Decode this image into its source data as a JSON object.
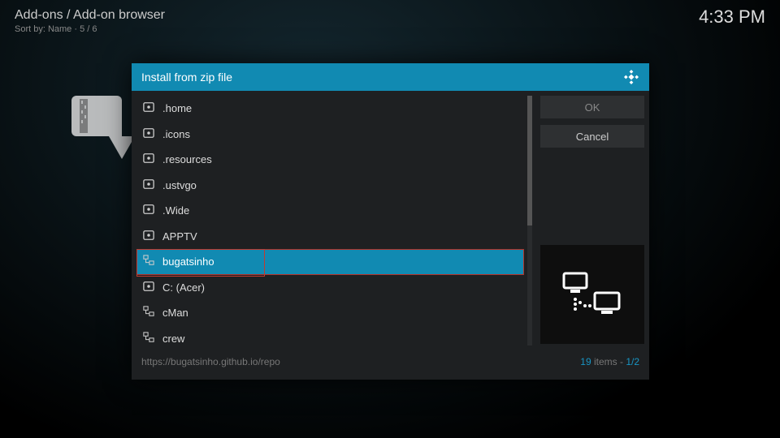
{
  "breadcrumb": "Add-ons / Add-on browser",
  "sortby": "Sort by: Name  ·  5 / 6",
  "clock": "4:33 PM",
  "dialog": {
    "title": "Install from zip file",
    "items": [
      {
        "label": ".home",
        "icon": "disk"
      },
      {
        "label": ".icons",
        "icon": "disk"
      },
      {
        "label": ".resources",
        "icon": "disk"
      },
      {
        "label": ".ustvgo",
        "icon": "disk"
      },
      {
        "label": ".Wide",
        "icon": "disk"
      },
      {
        "label": "APPTV",
        "icon": "disk"
      },
      {
        "label": "bugatsinho",
        "icon": "net",
        "selected": true
      },
      {
        "label": "C: (Acer)",
        "icon": "disk"
      },
      {
        "label": "cMan",
        "icon": "net"
      },
      {
        "label": "crew",
        "icon": "net"
      }
    ],
    "buttons": {
      "ok": "OK",
      "cancel": "Cancel"
    },
    "footer": {
      "path": "https://bugatsinho.github.io/repo",
      "count": "19",
      "count_label": " items - ",
      "page": "1/2"
    }
  }
}
